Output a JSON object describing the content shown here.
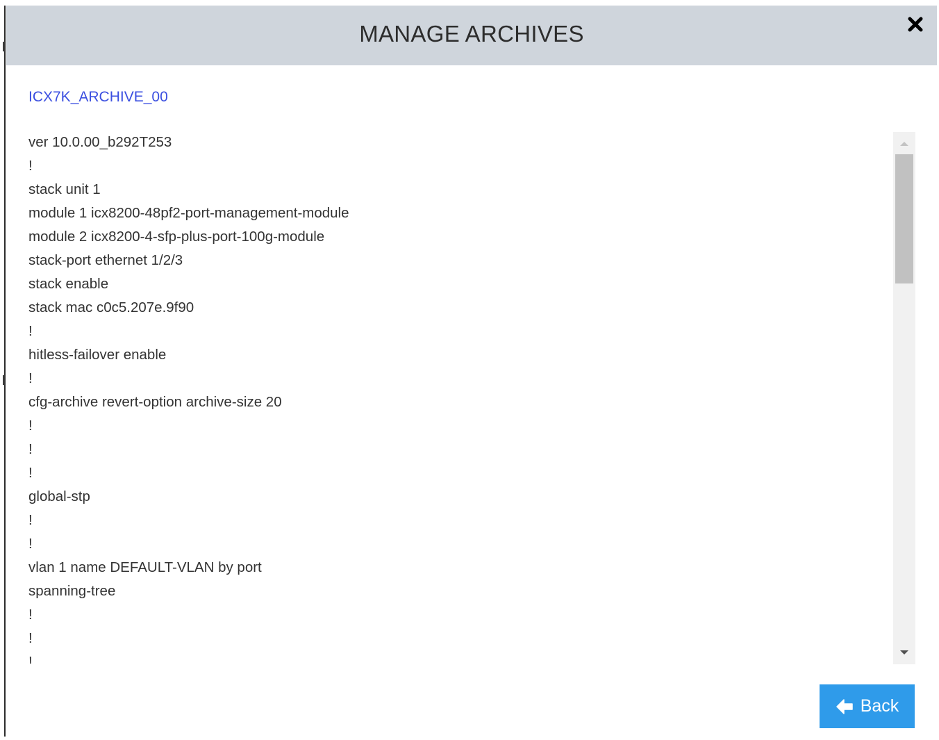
{
  "modal": {
    "title": "MANAGE ARCHIVES",
    "archive_name": "ICX7K_ARCHIVE_00"
  },
  "config_lines": [
    "ver 10.0.00_b292T253",
    "!",
    "stack unit 1",
    "module 1 icx8200-48pf2-port-management-module",
    "module 2 icx8200-4-sfp-plus-port-100g-module",
    "stack-port ethernet 1/2/3",
    "stack enable",
    "stack mac c0c5.207e.9f90",
    "!",
    "hitless-failover enable",
    "!",
    "cfg-archive revert-option archive-size 20",
    "!",
    "!",
    "!",
    "global-stp",
    "!",
    "!",
    "vlan 1 name DEFAULT-VLAN by port",
    "spanning-tree",
    "!",
    "!",
    "!"
  ],
  "footer": {
    "back_label": "Back"
  },
  "icons": {
    "close": "close-icon",
    "back": "arrow-left-icon",
    "scroll_up": "triangle-up-icon",
    "scroll_down": "triangle-down-icon"
  },
  "colors": {
    "header_bg": "#cfd5dc",
    "archive_link": "#3b4fe0",
    "back_button": "#2f9bea"
  }
}
